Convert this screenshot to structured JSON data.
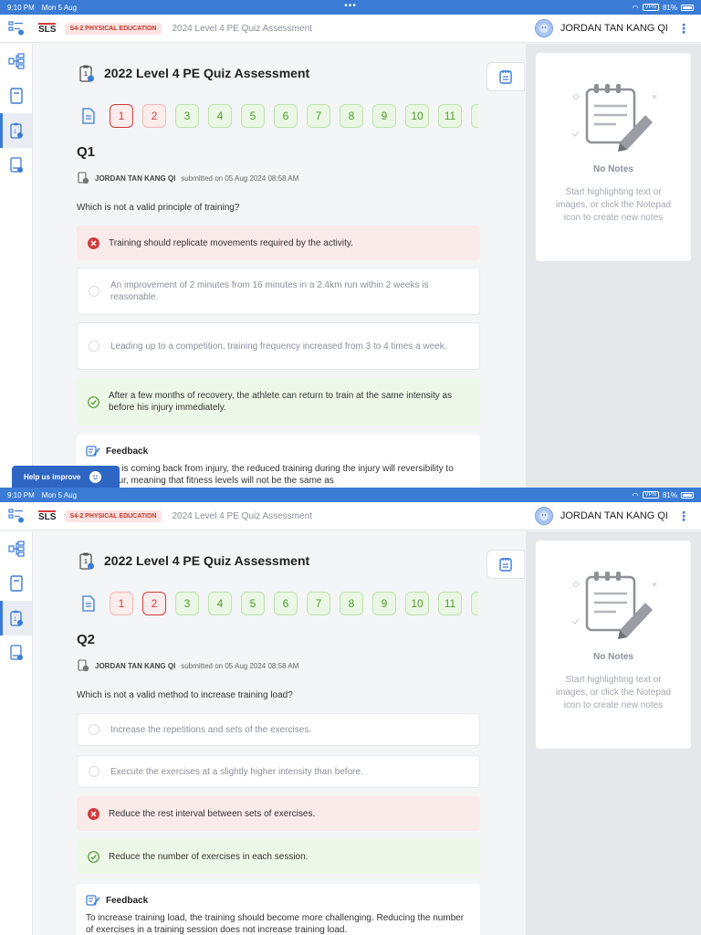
{
  "screens": [
    {
      "status": {
        "time": "9:10 PM",
        "date": "Mon 5 Aug",
        "battery": "81%",
        "vpn": "VPN"
      },
      "header": {
        "brand": "SLS",
        "class_badge": "S4-2 PHYSICAL EDUCATION",
        "breadcrumb": "2024 Level 4 PE Quiz Assessment",
        "user": "JORDAN TAN KANG QI"
      },
      "quiz": {
        "title": "2022 Level 4 PE Quiz Assessment",
        "nav": [
          "1",
          "2",
          "3",
          "4",
          "5",
          "6",
          "7",
          "8",
          "9",
          "10",
          "11"
        ],
        "question_label": "Q1",
        "submitter_name": "JORDAN TAN KANG QI",
        "submitted_text": "submitted on 05 Aug 2024 08:58 AM",
        "question_text": "Which is not a valid principle of training?",
        "options": [
          "Training should replicate movements required by the activity.",
          "An improvement of 2 minutes from 16 minutes in a 2.4km run within 2 weeks is reasonable.",
          "Leading up to a competition, training frequency increased from 3 to 4 times a week.",
          "After a few months of recovery, the athlete can return to train at the same intensity as before his injury immediately."
        ],
        "feedback_title": "Feedback",
        "feedback_text": "one is coming back from injury, the reduced training during the injury will reversibility to occur, meaning that fitness levels will not be the same as"
      },
      "notes": {
        "title": "No Notes",
        "description": "Start highlighting text or images, or click the Notepad icon to create new notes"
      },
      "help": "Help us improve"
    },
    {
      "status": {
        "time": "9:10 PM",
        "date": "Mon 5 Aug",
        "battery": "81%",
        "vpn": "VPN"
      },
      "header": {
        "brand": "SLS",
        "class_badge": "S4-2 PHYSICAL EDUCATION",
        "breadcrumb": "2024 Level 4 PE Quiz Assessment",
        "user": "JORDAN TAN KANG QI"
      },
      "quiz": {
        "title": "2022 Level 4 PE Quiz Assessment",
        "nav": [
          "1",
          "2",
          "3",
          "4",
          "5",
          "6",
          "7",
          "8",
          "9",
          "10",
          "11"
        ],
        "question_label": "Q2",
        "submitter_name": "JORDAN TAN KANG QI",
        "submitted_text": "submitted on 05 Aug 2024 08:58 AM",
        "question_text": "Which is not a valid method to increase training load?",
        "options": [
          "Increase the repetitions and sets of the exercises.",
          "Execute the exercises at a slightly higher intensity than before.",
          "Reduce the rest interval between sets of exercises.",
          "Reduce the number of exercises in each session."
        ],
        "feedback_title": "Feedback",
        "feedback_text": "To increase training load, the training should become more challenging. Reducing the number of exercises in a training session does not increase training load."
      },
      "notes": {
        "title": "No Notes",
        "description": "Start highlighting text or images, or click the Notepad icon to create new notes"
      }
    }
  ],
  "colors": {
    "accent": "#3a7bd5",
    "wrong": "#d03b3b",
    "correct": "#4f9a2f",
    "help": "#2f66c4"
  }
}
